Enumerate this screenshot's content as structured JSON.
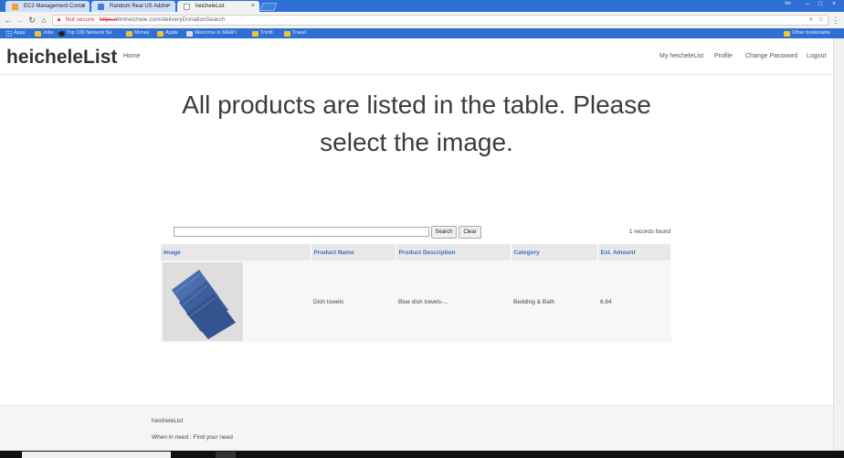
{
  "browser": {
    "tabs": [
      {
        "label": "EC2 Management Conso",
        "favicon_color": "#f0a030"
      },
      {
        "label": "Random Real US Addre",
        "favicon_color": "#4a7bd0"
      },
      {
        "label": "heicheleList",
        "favicon_color": "#ffffff"
      }
    ],
    "window_user": "tim",
    "omnibox": {
      "security_label": "Not secure",
      "url_scheme": "https://",
      "url_rest": "timheichele.com/deliveryDonationSearch"
    },
    "bookmarks": [
      {
        "label": "Apps",
        "icon": "apps-icon"
      },
      {
        "label": "Jobs",
        "icon": "folder-icon"
      },
      {
        "label": "Top 100 Network Se",
        "icon": "eye-icon"
      },
      {
        "label": "Money",
        "icon": "folder-icon"
      },
      {
        "label": "Apple",
        "icon": "folder-icon"
      },
      {
        "label": "Welcome to M&M I",
        "icon": "site-icon"
      },
      {
        "label": "Trimfi",
        "icon": "folder-icon"
      },
      {
        "label": "Travel",
        "icon": "folder-icon"
      },
      {
        "label": "Other bookmarks",
        "icon": "folder-icon"
      }
    ]
  },
  "site": {
    "brand": "heicheleList",
    "nav_left": [
      "Home"
    ],
    "nav_right": [
      "My heicheleList",
      "Profile",
      "Change Password",
      "Logout"
    ]
  },
  "hero": {
    "line1": "All products are listed in the table. Please",
    "line2": "select the image."
  },
  "search": {
    "value": "",
    "search_label": "Search",
    "clear_label": "Clear",
    "records_found": "1 records found"
  },
  "table": {
    "headers": [
      "Image",
      "Product Name",
      "Product Description",
      "Category",
      "Est. Amount"
    ],
    "rows": [
      {
        "image": "dish-towels-image",
        "name": "Dish towels",
        "description": "Blue dish towels-...",
        "category": "Bedding & Bath",
        "amount": "6.84"
      }
    ]
  },
  "footer": {
    "brand": "heicheleList",
    "tagline": "When in need : Find your need"
  },
  "colors": {
    "chrome_blue": "#2d6fd2",
    "link_blue": "#3a6fc4",
    "towel_blue": "#3d5f9e"
  }
}
